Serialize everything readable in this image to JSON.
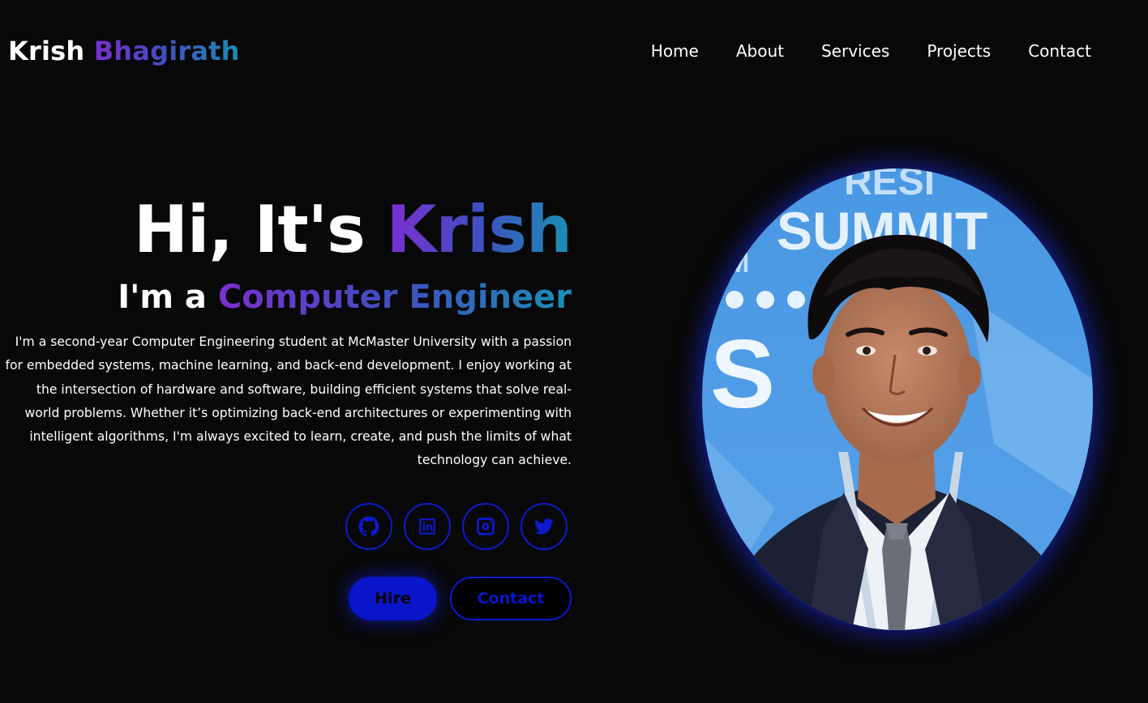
{
  "header": {
    "logo_first": "Krish",
    "logo_last": "Bhagirath",
    "nav": [
      {
        "label": "Home"
      },
      {
        "label": "About"
      },
      {
        "label": "Services"
      },
      {
        "label": "Projects"
      },
      {
        "label": "Contact"
      }
    ]
  },
  "hero": {
    "title_prefix": "Hi, It's",
    "title_name": "Krish",
    "subtitle_prefix": "I'm a",
    "subtitle_role": "Computer Engineer",
    "description": "I'm a second-year Computer Engineering student at McMaster University with a passion for embedded systems, machine learning, and back-end development. I enjoy working at the intersection of hardware and software, building efficient systems that solve real-world problems. Whether it’s optimizing back-end architectures or experimenting with intelligent algorithms, I'm always excited to learn, create, and push the limits of what technology can achieve.",
    "socials": [
      {
        "icon": "github-icon"
      },
      {
        "icon": "linkedin-icon"
      },
      {
        "icon": "instagram-icon"
      },
      {
        "icon": "twitter-icon"
      }
    ],
    "hire_label": "Hire",
    "contact_label": "Contact"
  },
  "photo": {
    "backdrop_text_top": "RESI",
    "backdrop_text_main": "SUMMIT",
    "backdrop_text_left": "S",
    "backdrop_text_small": "M"
  },
  "colors": {
    "background": "#080808",
    "accent_blue": "#0a14c8",
    "gradient_start": "#7b2fd0",
    "gradient_end": "#1a8fb5"
  }
}
